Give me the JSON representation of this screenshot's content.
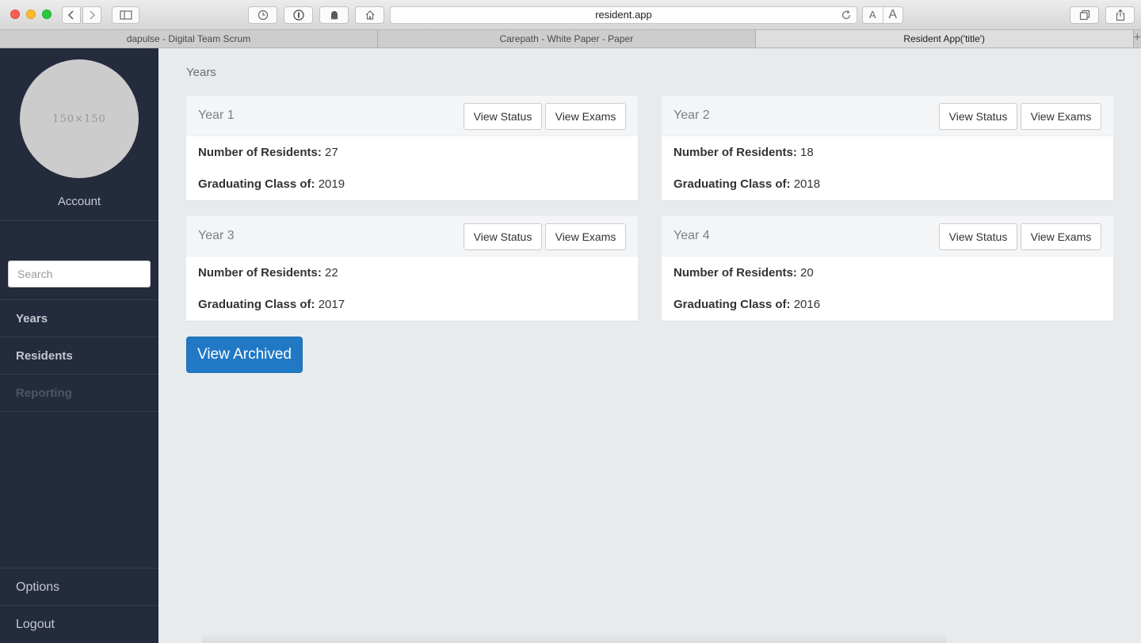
{
  "browser": {
    "url": "resident.app",
    "font_small": "A",
    "font_large": "A",
    "tabs": [
      {
        "label": "dapulse - Digital Team Scrum"
      },
      {
        "label": "Carepath - White Paper - Paper"
      },
      {
        "label": "Resident App('title')"
      }
    ],
    "new_tab": "+"
  },
  "sidebar": {
    "avatar_placeholder": "150×150",
    "account_label": "Account",
    "search_placeholder": "Search",
    "nav": [
      {
        "label": "Years"
      },
      {
        "label": "Residents"
      },
      {
        "label": "Reporting"
      }
    ],
    "bottom": [
      {
        "label": "Options"
      },
      {
        "label": "Logout"
      }
    ]
  },
  "main": {
    "page_title": "Years",
    "residents_label": "Number of Residents:",
    "class_label": "Graduating Class of:",
    "view_status_label": "View Status",
    "view_exams_label": "View Exams",
    "years": [
      {
        "title": "Year 1",
        "residents": "27",
        "class": "2019"
      },
      {
        "title": "Year 2",
        "residents": "18",
        "class": "2018"
      },
      {
        "title": "Year 3",
        "residents": "22",
        "class": "2017"
      },
      {
        "title": "Year 4",
        "residents": "20",
        "class": "2016"
      }
    ],
    "view_archived_label": "View Archived"
  }
}
